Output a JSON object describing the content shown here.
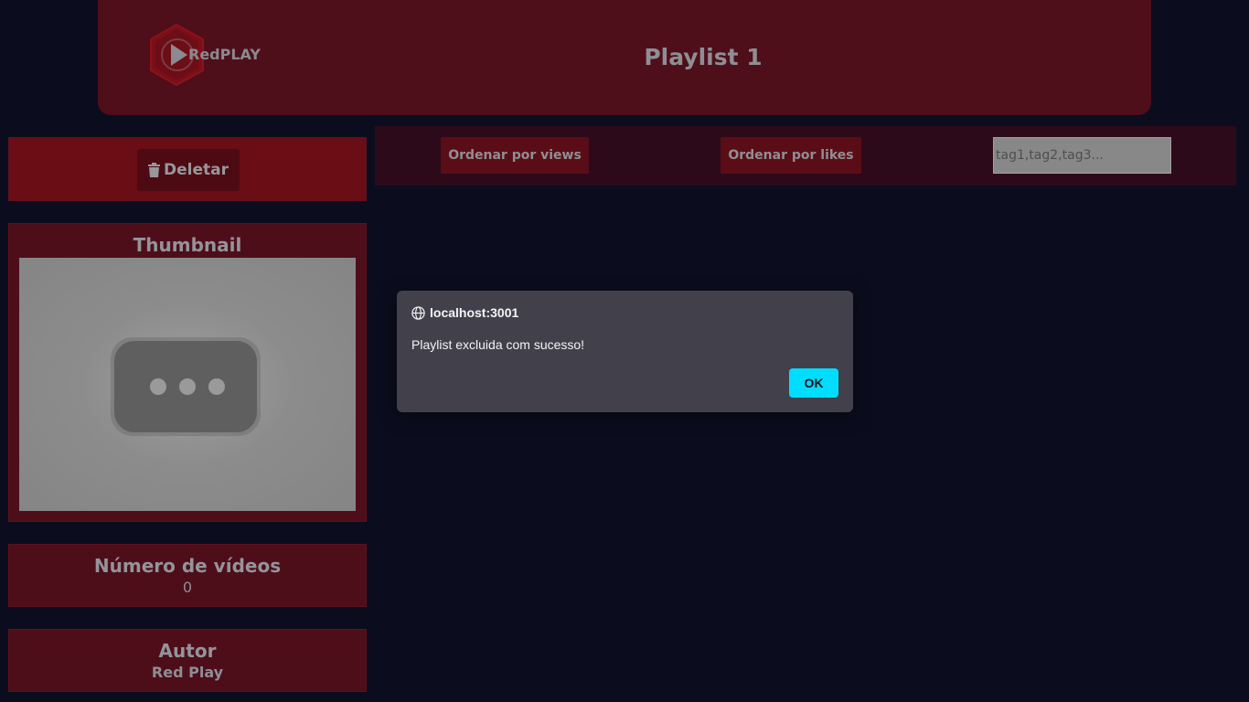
{
  "header": {
    "logo_text": "RedPLAY",
    "title": "Playlist 1"
  },
  "sidebar": {
    "delete_label": "Deletar",
    "thumbnail_title": "Thumbnail",
    "video_count_title": "Número de vídeos",
    "video_count_value": "0",
    "author_title": "Autor",
    "author_value": "Red Play"
  },
  "toolbar": {
    "sort_views_label": "Ordenar por views",
    "sort_likes_label": "Ordenar por likes",
    "tags_placeholder": "tag1,tag2,tag3..."
  },
  "dialog": {
    "origin": "localhost:3001",
    "message": "Playlist excluida com sucesso!",
    "ok_label": "OK"
  },
  "icons": {
    "logo": "play-hexagon-icon",
    "delete": "trash-icon",
    "thumbnail_placeholder": "loading-dots-icon",
    "origin": "globe-icon"
  },
  "colors": {
    "background": "#0b0d1e",
    "header": "#4e0e1a",
    "delete_panel": "#6a0d14",
    "dialog_background": "#42414b",
    "ok_button": "#00ddff"
  }
}
